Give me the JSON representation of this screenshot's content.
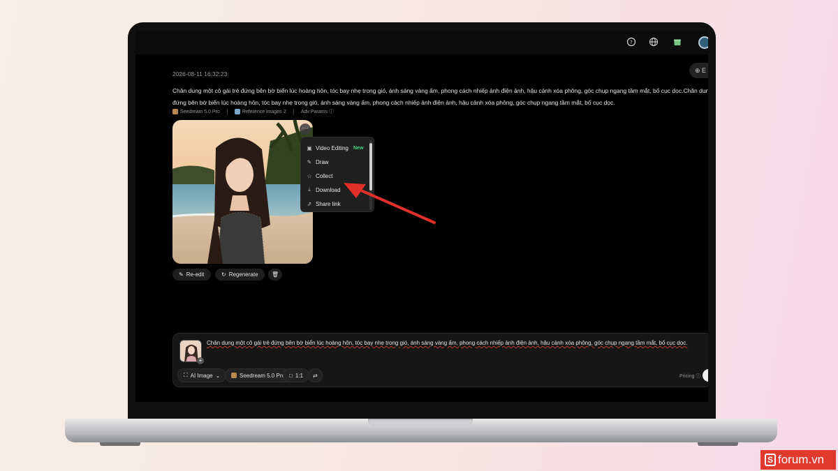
{
  "header": {
    "explore_label": "E"
  },
  "timestamp": "2026-08-11 16:32:23",
  "prompt": {
    "line1": "Chân dung một cô gái trẻ đứng bên bờ biển lúc hoàng hôn, tóc bay nhẹ trong gió, ánh sáng vàng ấm, phong cách nhiếp ảnh điện ảnh, hậu cảnh xóa phông, góc chụp ngang tầm mắt, bố cục dọc.Chân dung một c",
    "line2": "đứng bên bờ biển lúc hoàng hôn, tóc bay nhẹ trong gió, ánh sáng vàng ấm, phong cách nhiếp ảnh điện ảnh, hậu cảnh xóa phông, góc chụp ngang tầm mắt, bố cục dọc."
  },
  "meta": {
    "model": "Seedream 5.0 Pro",
    "reference": "Reference images·2",
    "adv_params": "Adv Params ⓘ"
  },
  "context_menu": {
    "items": [
      {
        "label": "Video Editing",
        "icon": "video-edit-icon",
        "badge": "New"
      },
      {
        "label": "Draw",
        "icon": "pencil-icon"
      },
      {
        "label": "Collect",
        "icon": "star-icon"
      },
      {
        "label": "Download",
        "icon": "download-icon"
      },
      {
        "label": "Share link",
        "icon": "share-icon"
      }
    ]
  },
  "actions": {
    "reedit": "Re-edit",
    "regenerate": "Regenerate"
  },
  "composer": {
    "text": "Chân dung một cô gái trẻ đứng bên bờ biển lúc hoàng hôn, tóc bay nhẹ trong gió, ánh sáng vàng ấm, phong cách nhiếp ảnh điện ảnh, hậu cảnh xóa phông, góc chụp ngang tầm mắt, bố cục dọc.",
    "mode": "AI Image",
    "model": "Seedream 5.0 Pro",
    "ratio": "1:1",
    "pricing": "Pricing ⓘ"
  },
  "watermark": {
    "logo": "S",
    "text": "forum.vn"
  },
  "colors": {
    "accent_new": "#3ddc84",
    "arrow": "#e0302a",
    "watermark_bg": "#e03a2e"
  }
}
